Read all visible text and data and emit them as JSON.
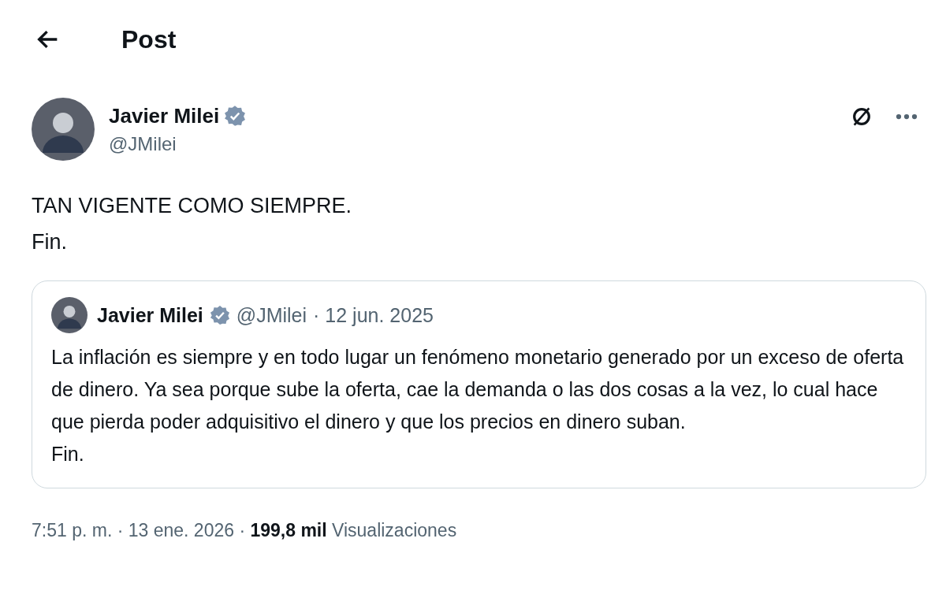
{
  "header": {
    "title": "Post"
  },
  "post": {
    "author": {
      "name": "Javier Milei",
      "handle": "@JMilei",
      "verified": true
    },
    "body": [
      "TAN VIGENTE COMO SIEMPRE.",
      "Fin."
    ],
    "quote": {
      "author": {
        "name": "Javier Milei",
        "handle": "@JMilei",
        "verified": true
      },
      "date": "· 12 jun. 2025",
      "paragraphs": [
        "La inflación es siempre y en todo lugar un fenómeno monetario generado por un exceso de oferta de dinero. Ya sea porque sube la oferta, cae la demanda o las dos cosas a la vez, lo cual hace que pierda poder adquisitivo el dinero y que los precios en dinero suban.",
        "Fin."
      ]
    },
    "footer": "7:51 p. m. · 13 ene. 2026 · **199,8 mil** Visualizaciones"
  }
}
